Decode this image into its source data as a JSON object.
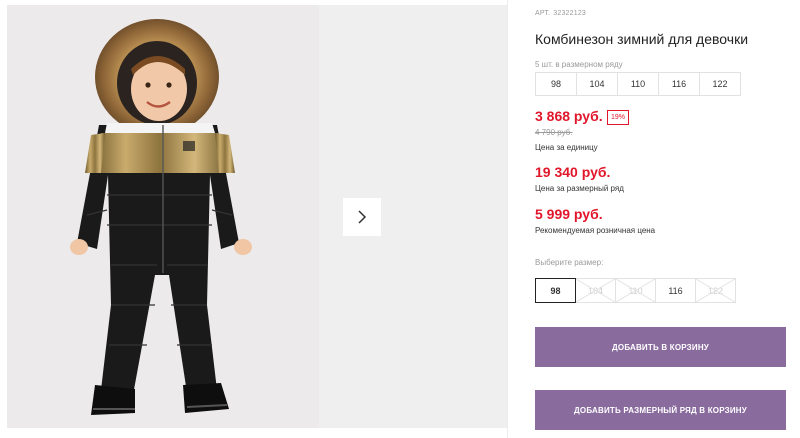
{
  "product": {
    "article_label": "АРТ.",
    "article_number": "32322123",
    "title": "Комбинезон зимний для девочки"
  },
  "size_row": {
    "label": "5 шт. в размерном ряду",
    "sizes": [
      "98",
      "104",
      "110",
      "116",
      "122"
    ]
  },
  "pricing": {
    "unit_price": "3 868 руб.",
    "discount": "19%",
    "old_price": "4 790 руб.",
    "unit_caption": "Цена за единицу",
    "row_price": "19 340 руб.",
    "row_caption": "Цена за размерный ряд",
    "retail_price": "5 999 руб.",
    "retail_caption": "Рекомендуемая розничная цена"
  },
  "size_select": {
    "label": "Выберите размер:",
    "options": [
      {
        "label": "98",
        "state": "selected"
      },
      {
        "label": "104",
        "state": "disabled"
      },
      {
        "label": "110",
        "state": "disabled"
      },
      {
        "label": "116",
        "state": "available"
      },
      {
        "label": "122",
        "state": "disabled"
      }
    ]
  },
  "buttons": {
    "add_to_cart": "ДОБАВИТЬ В КОРЗИНУ",
    "add_row_to_cart": "ДОБАВИТЬ РАЗМЕРНЫЙ РЯД В КОРЗИНУ"
  },
  "gallery": {
    "next_icon": "chevron-right-icon"
  },
  "colors": {
    "price": "#e2162b",
    "button": "#8a6b9e",
    "photo_bg": "#eceaea"
  }
}
